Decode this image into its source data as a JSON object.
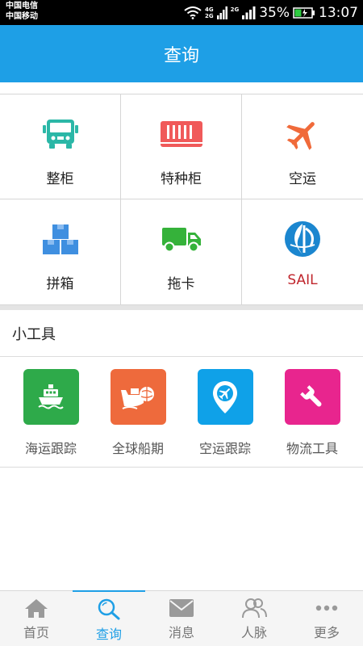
{
  "status_bar": {
    "carrier1": "中国电信",
    "carrier2": "中国移动",
    "net_top": "4G",
    "net_bottom": "2G",
    "net3": "2G",
    "battery": "35%",
    "time": "13:07"
  },
  "header": {
    "title": "查询"
  },
  "grid": {
    "items": [
      {
        "label": "整柜",
        "icon": "truck-front-icon",
        "color": "#2BB7A7"
      },
      {
        "label": "特种柜",
        "icon": "container-icon",
        "color": "#F05A5A"
      },
      {
        "label": "空运",
        "icon": "airplane-icon",
        "color": "#F06A3A"
      },
      {
        "label": "拼箱",
        "icon": "boxes-icon",
        "color": "#3F8FE0"
      },
      {
        "label": "拖卡",
        "icon": "truck-side-icon",
        "color": "#35B23A"
      },
      {
        "label": "SAIL",
        "icon": "sail-logo",
        "color": "#C0262D"
      }
    ]
  },
  "tools": {
    "title": "小工具",
    "items": [
      {
        "label": "海运跟踪",
        "icon": "ship-icon",
        "color": "#2EAA4A"
      },
      {
        "label": "全球船期",
        "icon": "globe-ship-icon",
        "color": "#EE6A3C"
      },
      {
        "label": "空运跟踪",
        "icon": "location-plane-icon",
        "color": "#0FA1E8"
      },
      {
        "label": "物流工具",
        "icon": "wrench-icon",
        "color": "#E8258E"
      }
    ]
  },
  "tabbar": {
    "items": [
      {
        "label": "首页",
        "icon": "home-icon"
      },
      {
        "label": "查询",
        "icon": "search-icon"
      },
      {
        "label": "消息",
        "icon": "mail-icon"
      },
      {
        "label": "人脉",
        "icon": "contacts-icon"
      },
      {
        "label": "更多",
        "icon": "more-icon"
      }
    ],
    "active": "查询",
    "active_color": "#1E9FE6"
  }
}
